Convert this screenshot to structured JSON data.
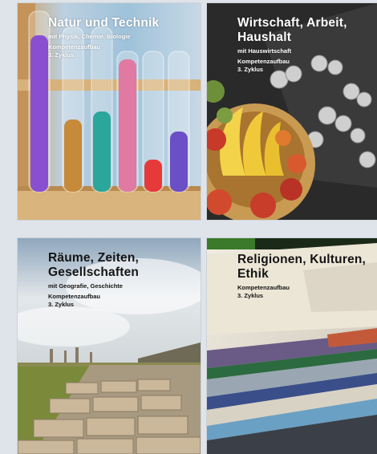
{
  "cards": [
    {
      "title": "Natur und Technik",
      "subtitle": "mit Physik, Chemie, Biologie",
      "line1": "Kompetenzaufbau",
      "line2": "3. Zyklus"
    },
    {
      "title": "Wirtschaft, Arbeit, Haushalt",
      "subtitle": "mit Hauswirtschaft",
      "line1": "Kompetenzaufbau",
      "line2": "3. Zyklus"
    },
    {
      "title": "Räume, Zeiten, Gesellschaften",
      "subtitle": "mit Geografie, Geschichte",
      "line1": "Kompetenzaufbau",
      "line2": "3. Zyklus"
    },
    {
      "title": "Religionen, Kulturen, Ethik",
      "subtitle": "",
      "line1": "Kompetenzaufbau",
      "line2": "3. Zyklus"
    }
  ]
}
